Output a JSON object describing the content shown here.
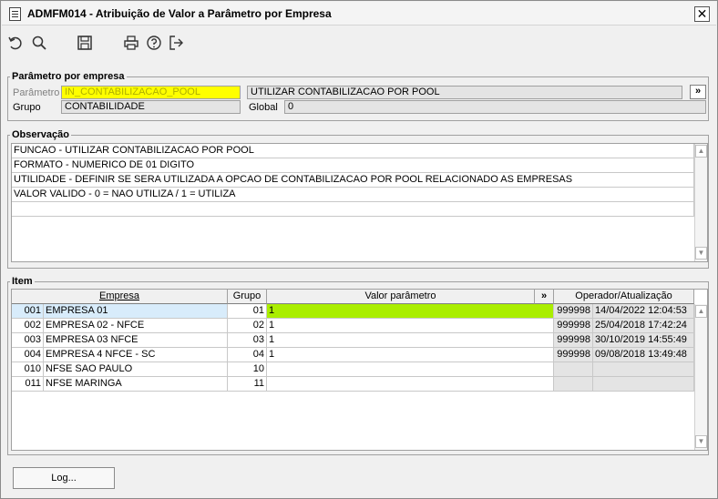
{
  "window": {
    "title": "ADMFM014 - Atribuição de Valor a Parâmetro por Empresa",
    "close_glyph": "✕"
  },
  "toolbar": {
    "icons": [
      "undo-icon",
      "search-icon",
      "save-icon",
      "print-icon",
      "help-icon",
      "exit-icon"
    ]
  },
  "parametro": {
    "legend": "Parâmetro por empresa",
    "param_label": "Parâmetro",
    "param_value": "IN_CONTABILIZACAO_POOL",
    "description": "UTILIZAR CONTABILIZACAO POR POOL",
    "more_button": "»",
    "grupo_label": "Grupo",
    "grupo_value": "CONTABILIDADE",
    "global_label": "Global",
    "global_value": "0"
  },
  "observacao": {
    "legend": "Observação",
    "lines": [
      "FUNCAO - UTILIZAR CONTABILIZACAO POR POOL",
      "FORMATO - NUMERICO DE 01 DIGITO",
      "UTILIDADE - DEFINIR SE SERA UTILIZADA A OPCAO DE CONTABILIZACAO POR POOL RELACIONADO AS EMPRESAS",
      "VALOR VALIDO - 0 = NAO UTILIZA / 1 = UTILIZA",
      ""
    ]
  },
  "item": {
    "legend": "Item",
    "columns": {
      "empresa": "Empresa",
      "grupo": "Grupo",
      "valor": "Valor parâmetro",
      "valor_btn": "»",
      "operador": "Operador/Atualização"
    },
    "rows": [
      {
        "code": "001",
        "name": "EMPRESA 01",
        "grupo": "01",
        "valor": "1",
        "operador": "999998",
        "data": "14/04/2022 12:04:53"
      },
      {
        "code": "002",
        "name": "EMPRESA 02 - NFCE",
        "grupo": "02",
        "valor": "1",
        "operador": "999998",
        "data": "25/04/2018 17:42:24"
      },
      {
        "code": "003",
        "name": "EMPRESA 03 NFCE",
        "grupo": "03",
        "valor": "1",
        "operador": "999998",
        "data": "30/10/2019 14:55:49"
      },
      {
        "code": "004",
        "name": "EMPRESA 4 NFCE - SC",
        "grupo": "04",
        "valor": "1",
        "operador": "999998",
        "data": "09/08/2018 13:49:48"
      },
      {
        "code": "010",
        "name": "NFSE SAO PAULO",
        "grupo": "10",
        "valor": "",
        "operador": "",
        "data": ""
      },
      {
        "code": "011",
        "name": "NFSE MARINGA",
        "grupo": "11",
        "valor": "",
        "operador": "",
        "data": ""
      }
    ]
  },
  "footer": {
    "log_button": "Log..."
  }
}
